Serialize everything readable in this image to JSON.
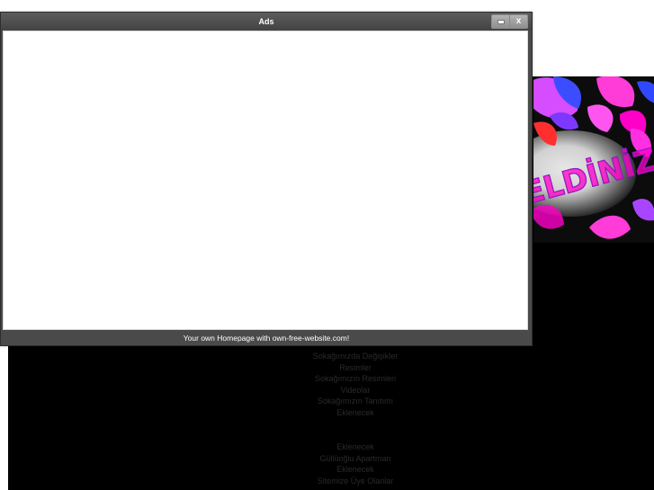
{
  "popup": {
    "title": "Ads",
    "controls": {
      "minimize_icon": "minimize-icon",
      "close_label": "x"
    },
    "footer_link": "Your own Homepage with own-free-website.com!"
  },
  "banner": {
    "text": "ELDİNİZ !!",
    "colors": {
      "pink": "#ff3bd8",
      "magenta": "#ff00c8",
      "purple": "#7d38ff",
      "blue": "#3048ff",
      "red": "#ff2f2f",
      "white": "#f5f5f5"
    }
  },
  "site": {
    "background": "#000000",
    "menu": [
      "Sokağımızda Değişikler",
      "Resimler",
      "Sokağımızın Resimleri",
      "Videolar",
      "Sokağımızın Tanıtımı",
      "Eklenecek",
      "",
      "Eklenecek",
      "Güllüoğlu Apartman",
      "Eklenecek",
      "Sitemize Üye Olanlar"
    ]
  }
}
